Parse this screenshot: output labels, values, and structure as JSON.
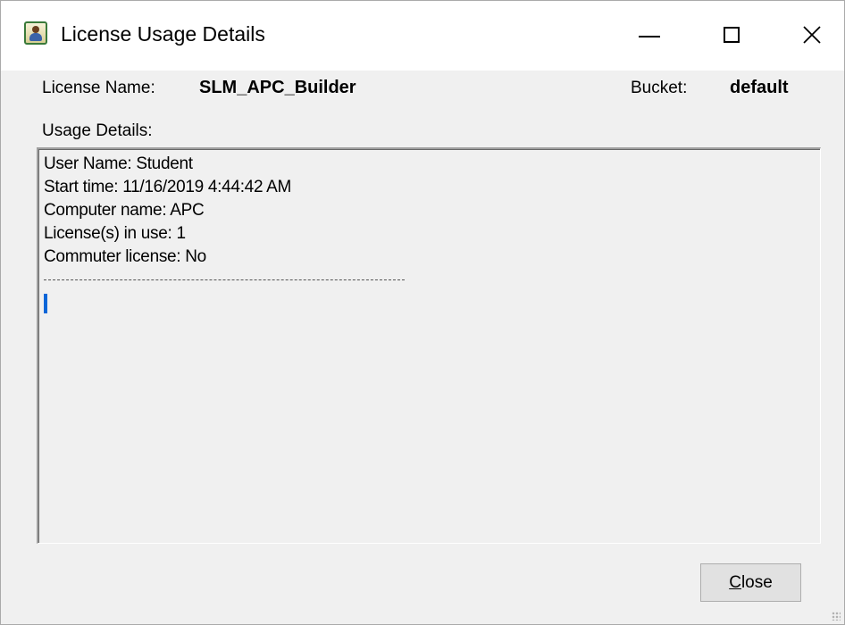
{
  "window": {
    "title": "License Usage Details",
    "controls": {
      "minimize": "minimize-icon",
      "maximize": "maximize-icon",
      "close": "close-icon"
    }
  },
  "license": {
    "name_label": "License Name:",
    "name_value": "SLM_APC_Builder",
    "bucket_label": "Bucket:",
    "bucket_value": "default"
  },
  "usage": {
    "label": "Usage Details:",
    "lines": [
      "User Name: Student",
      "Start time: 11/16/2019 4:44:42 AM",
      "Computer name: APC",
      "License(s) in use: 1",
      "Commuter license: No"
    ]
  },
  "buttons": {
    "close_first": "C",
    "close_rest": "lose"
  },
  "colors": {
    "caret": "#0a66d8",
    "window_bg": "#f0f0f0",
    "titlebar_bg": "#ffffff"
  }
}
